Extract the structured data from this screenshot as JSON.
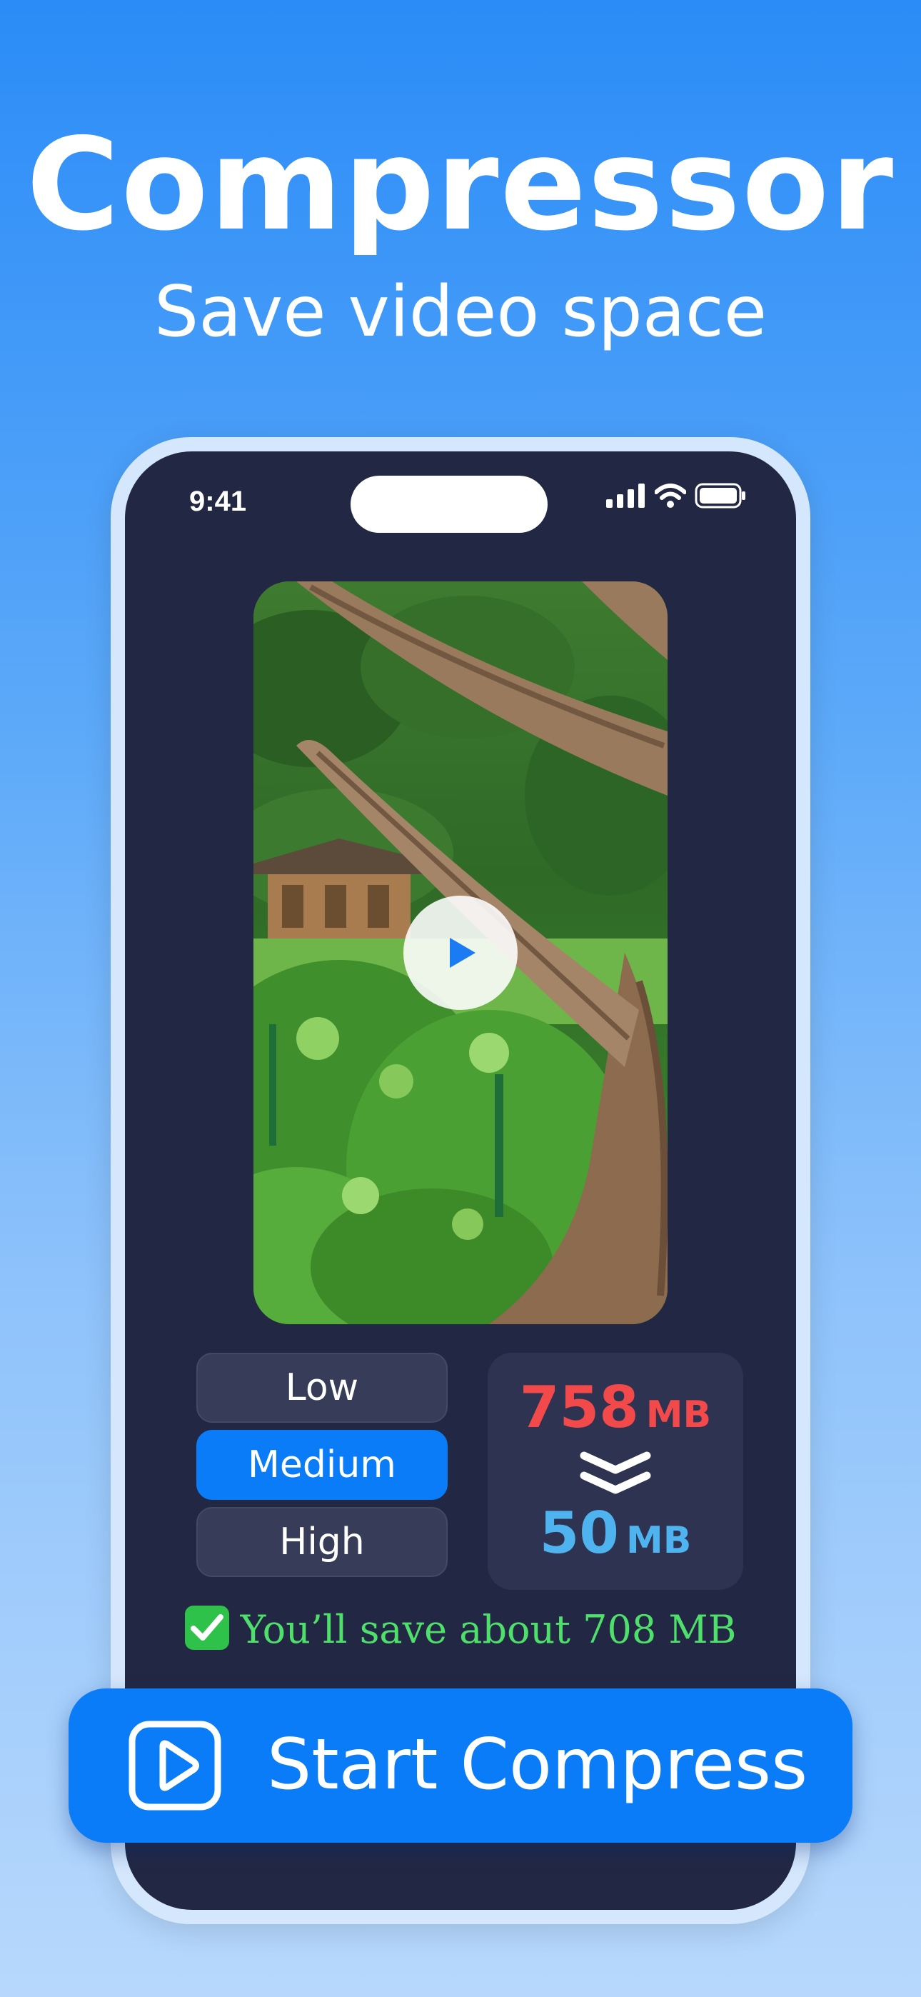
{
  "header": {
    "title": "Compressor",
    "subtitle": "Save video space"
  },
  "status_bar": {
    "time": "9:41",
    "icons": [
      "signal-icon",
      "wifi-icon",
      "battery-icon"
    ]
  },
  "video": {
    "description_icon": "play-icon"
  },
  "quality": {
    "options": [
      {
        "label": "Low",
        "selected": false
      },
      {
        "label": "Medium",
        "selected": true
      },
      {
        "label": "High",
        "selected": false
      }
    ]
  },
  "size": {
    "original_value": "758",
    "original_unit": "MB",
    "compressed_value": "50",
    "compressed_unit": "MB"
  },
  "savings_text": "You’ll save about 708 MB",
  "start_button": {
    "label": "Start Compress",
    "icon": "play-square-icon"
  },
  "colors": {
    "accent": "#0a7cf8",
    "original_size": "#f24a4a",
    "compressed_size": "#4fb3f0",
    "savings": "#4fe06b",
    "screen_bg": "#222843"
  }
}
